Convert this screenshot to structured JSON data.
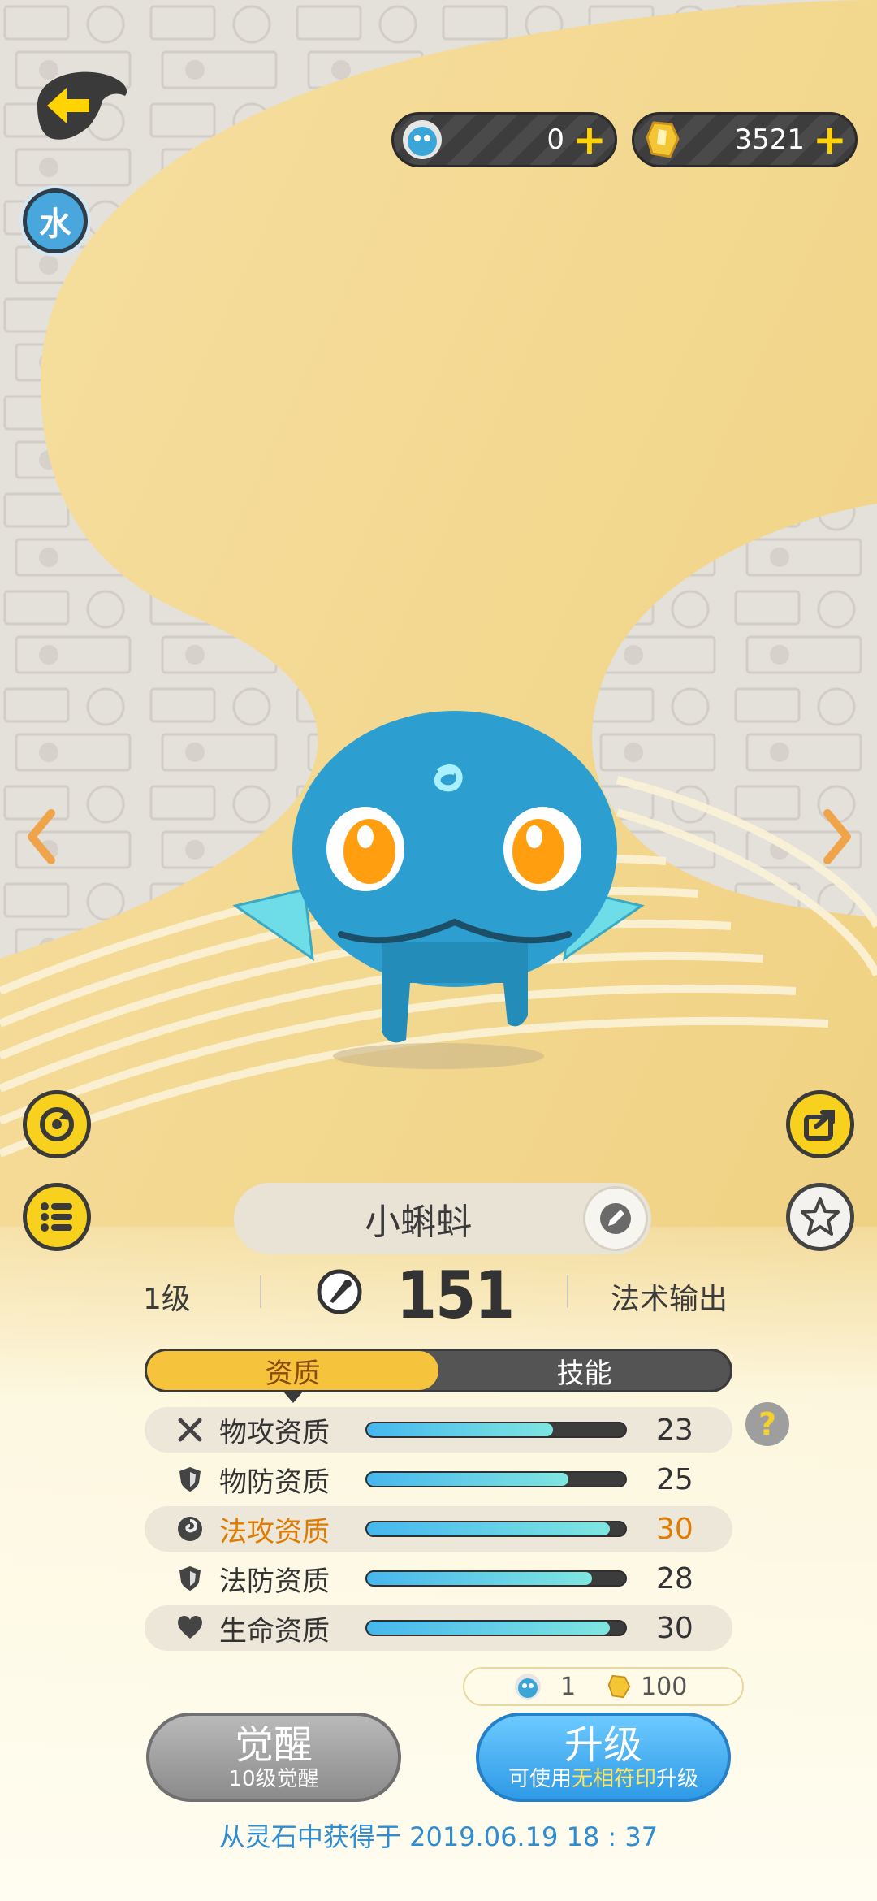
{
  "header": {
    "back_icon": "arrow-left-icon",
    "element_badge": "水"
  },
  "currencies": [
    {
      "icon": "blue-orb-icon",
      "value": "0",
      "plus": "+"
    },
    {
      "icon": "gold-crystal-icon",
      "value": "3521",
      "plus": "+"
    }
  ],
  "pet": {
    "name": "小蝌蚪",
    "level": "1级",
    "power": "151",
    "role": "法术输出"
  },
  "tabs": [
    {
      "label": "资质",
      "active": true
    },
    {
      "label": "技能",
      "active": false
    }
  ],
  "stats": [
    {
      "icon": "sword-cross-icon",
      "label": "物攻资质",
      "value": "23",
      "fill": 0.72,
      "shaded": true,
      "highlight": false
    },
    {
      "icon": "shield-icon",
      "label": "物防资质",
      "value": "25",
      "fill": 0.78,
      "shaded": false,
      "highlight": false
    },
    {
      "icon": "magic-swirl-icon",
      "label": "法攻资质",
      "value": "30",
      "fill": 0.94,
      "shaded": true,
      "highlight": true
    },
    {
      "icon": "shield-icon",
      "label": "法防资质",
      "value": "28",
      "fill": 0.87,
      "shaded": false,
      "highlight": false
    },
    {
      "icon": "heart-icon",
      "label": "生命资质",
      "value": "30",
      "fill": 0.94,
      "shaded": true,
      "highlight": false
    }
  ],
  "help": "?",
  "cost": {
    "orb": "1",
    "crystal": "100"
  },
  "buttons": {
    "awaken": {
      "label": "觉醒",
      "sub": "10级觉醒"
    },
    "upgrade": {
      "label": "升级",
      "sub_pre": "可使用",
      "sub_hl": "无相符印",
      "sub_post": "升级"
    }
  },
  "obtain_text": "从灵石中获得于 2019.06.19   18 : 37",
  "colors": {
    "accent_yellow": "#f7d11e",
    "accent_blue": "#2f9ae6",
    "highlight_orange": "#e07b00"
  }
}
